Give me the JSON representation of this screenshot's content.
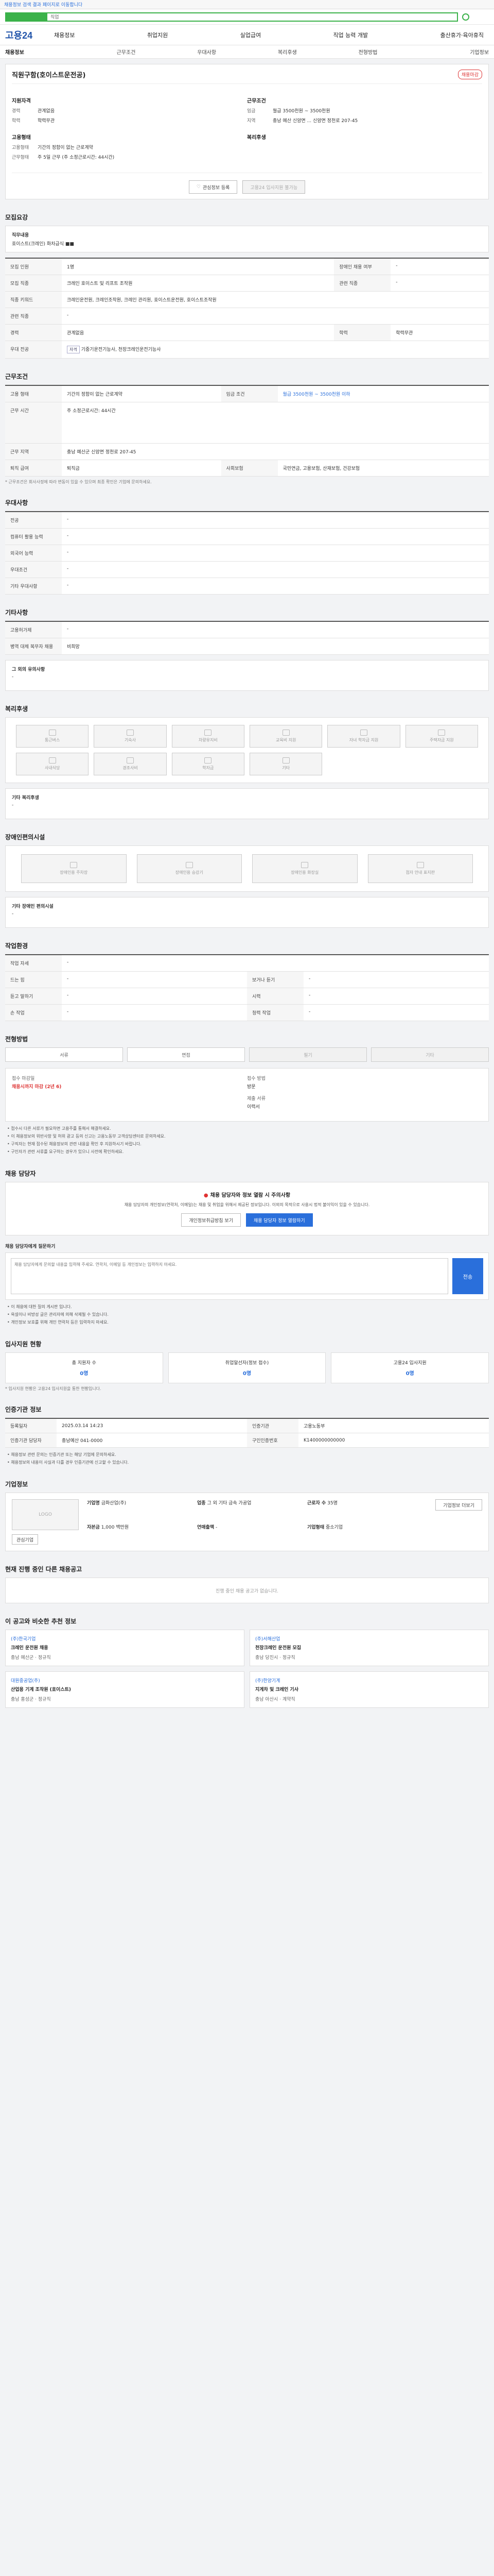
{
  "top": {
    "notice": "채용정보 검색 결과 페이지로 이동합니다",
    "search_text": "직업",
    "logo": "고용24",
    "menu": [
      "채용정보",
      "취업지원",
      "실업급여",
      "직업 능력 개발",
      "출산휴가·육아휴직"
    ],
    "lnb": [
      "채용정보",
      "근무조건",
      "우대사항",
      "복리후생",
      "전형방법",
      "기업정보"
    ]
  },
  "title": {
    "name": "직원구함(호이스트운전공)",
    "badge": "채용마감",
    "col1_head": "지원자격",
    "col1": [
      {
        "k": "경력",
        "v": "관계없음"
      },
      {
        "k": "학력",
        "v": "학력무관"
      }
    ],
    "col1b_head": "고용형태",
    "col1b": [
      {
        "k": "고용형태",
        "v": "기간의 정함이 없는 근로계약"
      },
      {
        "k": "근무형태",
        "v": "주 5일 근무 (주 소정근로시간: 44시간)"
      }
    ],
    "col2_head": "근무조건",
    "col2": [
      {
        "k": "임금",
        "v": "월급 3500천원 ~ 3500천원"
      },
      {
        "k": "지역",
        "v": "충남 예산 신암면 ... 신암면 정천로 207-45"
      }
    ],
    "col2b_head": "복리후생",
    "btn_fav": "관심정보 등록",
    "btn_apply": "고용24 입사지원 불가능"
  },
  "job": {
    "section": "모집요강",
    "duty_label": "직무내용",
    "duty_text": "호이스트(크레인) 화차급식 ■■",
    "rows": [
      {
        "k": "모집 인원",
        "v": "1명"
      },
      {
        "k": "모집 직종",
        "v": "크레인 호이스트 및 리프트 조작원"
      },
      {
        "k": "직종 키워드",
        "v": "크레인운전원, 크레인조작원, 크레인 관리원, 호이스트운전원, 호이스트조작원"
      },
      {
        "k": "관련 직종",
        "v": "-"
      },
      {
        "k": "경력",
        "v": "관계없음"
      },
      {
        "k": "학력",
        "v": "학력무관"
      },
      {
        "k": "우대 전공",
        "v": "기중기운전기능사, 천장크레인운전기능사"
      }
    ],
    "rows_right": [
      {
        "k": "장애인 채용 여부",
        "v": "-"
      },
      {
        "k": "관련 직종",
        "v": "-"
      }
    ]
  },
  "work": {
    "section": "근무조건",
    "rows": [
      {
        "k": "고용 형태",
        "v": "기간의 정함이 없는 근로계약"
      },
      {
        "k": "임금 조건",
        "v": "월급 3500천원 ~ 3500천원 이하"
      },
      {
        "k": "근무 시간",
        "v": "주 소정근로시간: 44시간"
      },
      {
        "k": "근무 지역",
        "v": "충남 예산군 신암면 정천로 207-45"
      },
      {
        "k": "퇴직 급여",
        "v": "퇴직금"
      },
      {
        "k": "사회보험",
        "v": "국민연금, 고용보험, 산재보험, 건강보험"
      }
    ],
    "note": "* 근무조건은 회사사정에 따라 변동이 있을 수 있으며 최종 확인은 기업에 문의하세요."
  },
  "pref": {
    "section": "우대사항",
    "rows": [
      {
        "k": "전공",
        "v": "-"
      },
      {
        "k": "컴퓨터 활용 능력",
        "v": "-"
      },
      {
        "k": "외국어 능력",
        "v": "-"
      },
      {
        "k": "우대조건",
        "v": "-"
      },
      {
        "k": "기타 우대사항",
        "v": "-"
      }
    ]
  },
  "etc": {
    "section": "기타사항",
    "rows": [
      {
        "k": "고용허가제",
        "v": "-"
      },
      {
        "k": "병역 대체 복무자 채용",
        "v": "비희망"
      }
    ],
    "extra_label": "그 외의 유의사항",
    "extra_value": "-"
  },
  "welfare": {
    "section": "복리후생",
    "items": [
      "통근버스",
      "기숙사",
      "차량유지비",
      "교육비 지원",
      "자녀 학자금 지원",
      "주택자금 지원",
      "사내식당",
      "경조사비",
      "학자금",
      "기타"
    ],
    "extra_label": "기타 복리후생",
    "extra_value": "-"
  },
  "disabled": {
    "section": "장애인편의시설",
    "items": [
      "장애인용 주차장",
      "장애인용 승강기",
      "장애인용 화장실",
      "점자 안내 표지판"
    ],
    "extra_label": "기타 장애인 편의시설",
    "extra_value": "-"
  },
  "env": {
    "section": "작업환경",
    "rows": [
      {
        "k": "작업 자세",
        "v": "-",
        "k2": "",
        "v2": ""
      },
      {
        "k": "드는 힘",
        "v": "-",
        "k2": "보거나 듣기",
        "v2": "-"
      },
      {
        "k": "듣고 말하기",
        "v": "-",
        "k2": "시력",
        "v2": "-"
      },
      {
        "k": "손 작업",
        "v": "-",
        "k2": "청력 작업",
        "v2": "-"
      }
    ]
  },
  "method": {
    "section": "전형방법",
    "tabs": [
      "서류",
      "면접",
      "필기",
      "기타"
    ],
    "apply_k1": "접수 마감일",
    "apply_v1": "채용시까지 마감 (2년 6)",
    "apply_k2": "접수 방법",
    "apply_v2": "방문",
    "apply_k3": "제출 서류",
    "apply_v3": "이력서",
    "bullets": [
      "접수시 다른 서류가 필요하면 고용주를 통해서 해결하세요.",
      "이 채용정보의 위반사항 및 허위 광고 등의 신고는 고용노동부 고객상담센터로 문의하세요.",
      "구직자는 현재 접수된 채용정보의 관련 내용을 확인 후 지원하시기 바랍니다.",
      "구인자가 관련 서류를 요구하는 경우가 있으니 사전에 확인하세요."
    ]
  },
  "qa": {
    "section": "채용 담당자",
    "warn_head": "채용 담당자와 정보 열람 시 주의사항",
    "warn_desc": "채용 담당자의 개인정보(연락처, 이메일)는 채용 및 취업을 위해서 제공된 정보입니다. 이외의 목적으로 사용시 법적 불이익이 있을 수 있습니다.",
    "btn_agree": "개인정보취급방침 보기",
    "btn_view": "채용 담당자 정보 열람하기",
    "ask_label": "채용 담당자에게 질문하기",
    "ask_placeholder": "채용 담당자에게 문의할 내용을 입력해 주세요. 연락처, 이메일 등 개인정보는 입력하지 마세요.",
    "ask_submit": "전송",
    "bullets": [
      "이 채용에 대한 질의 게시판 입니다.",
      "욕설이나 비방성 글은 관리자에 의해 삭제될 수 있습니다.",
      "개인정보 보호를 위해 개인 연락처 등은 입력하지 마세요."
    ]
  },
  "status": {
    "section": "입사지원 현황",
    "items": [
      {
        "k": "총 지원자 수",
        "v": "0명"
      },
      {
        "k": "취업알선자(정보 접수)",
        "v": "0명"
      },
      {
        "k": "고용24 입사지원",
        "v": "0명"
      }
    ],
    "note": "* 입사지원 현황은 고용24 입사지원을 통한 현황입니다."
  },
  "history": {
    "section": "인증기관 정보",
    "rows": [
      {
        "k": "등록일자",
        "v": "2025.03.14 14:23",
        "k2": "인증기관",
        "v2": "고용노동부"
      },
      {
        "k": "인증기관 담당자",
        "v": "충남예산 041-0000",
        "k2": "구인인증번호",
        "v2": "K1400000000000"
      }
    ],
    "bullets": [
      "채용정보 관련 문의는 인증기관 또는 해당 기업에 문의하세요.",
      "채용정보의 내용이 사실과 다를 경우 인증기관에 신고할 수 있습니다."
    ]
  },
  "corp": {
    "section": "기업정보",
    "logo_alt": "LOGO",
    "fields": [
      {
        "k": "기업명",
        "v": "금화산업(주)"
      },
      {
        "k": "업종",
        "v": "그 외 기타 금속 가공업"
      },
      {
        "k": "근로자 수",
        "v": "35명"
      },
      {
        "k": "자본금",
        "v": "1,000 백만원"
      },
      {
        "k": "연매출액",
        "v": "-"
      },
      {
        "k": "기업형태",
        "v": "중소기업"
      }
    ],
    "btn_more": "기업정보 더보기",
    "btn_fav": "관심기업"
  },
  "others": {
    "section": "현재 진행 중인 다른 채용공고",
    "empty": "진행 중인 채용 공고가 없습니다."
  },
  "recommend": {
    "section": "이 공고와 비슷한 추천 정보",
    "items": [
      {
        "co": "(주)한국기업",
        "job": "크레인 운전원 채용",
        "meta": "충남 예산군 · 정규직"
      },
      {
        "co": "(주)서해산업",
        "job": "천장크레인 운전원 모집",
        "meta": "충남 당진시 · 정규직"
      },
      {
        "co": "대원중공업(주)",
        "job": "산업용 기계 조작원 (호이스트)",
        "meta": "충남 홍성군 · 정규직"
      },
      {
        "co": "(주)한양기계",
        "job": "지게차 및 크레인 기사",
        "meta": "충남 아산시 · 계약직"
      }
    ]
  }
}
